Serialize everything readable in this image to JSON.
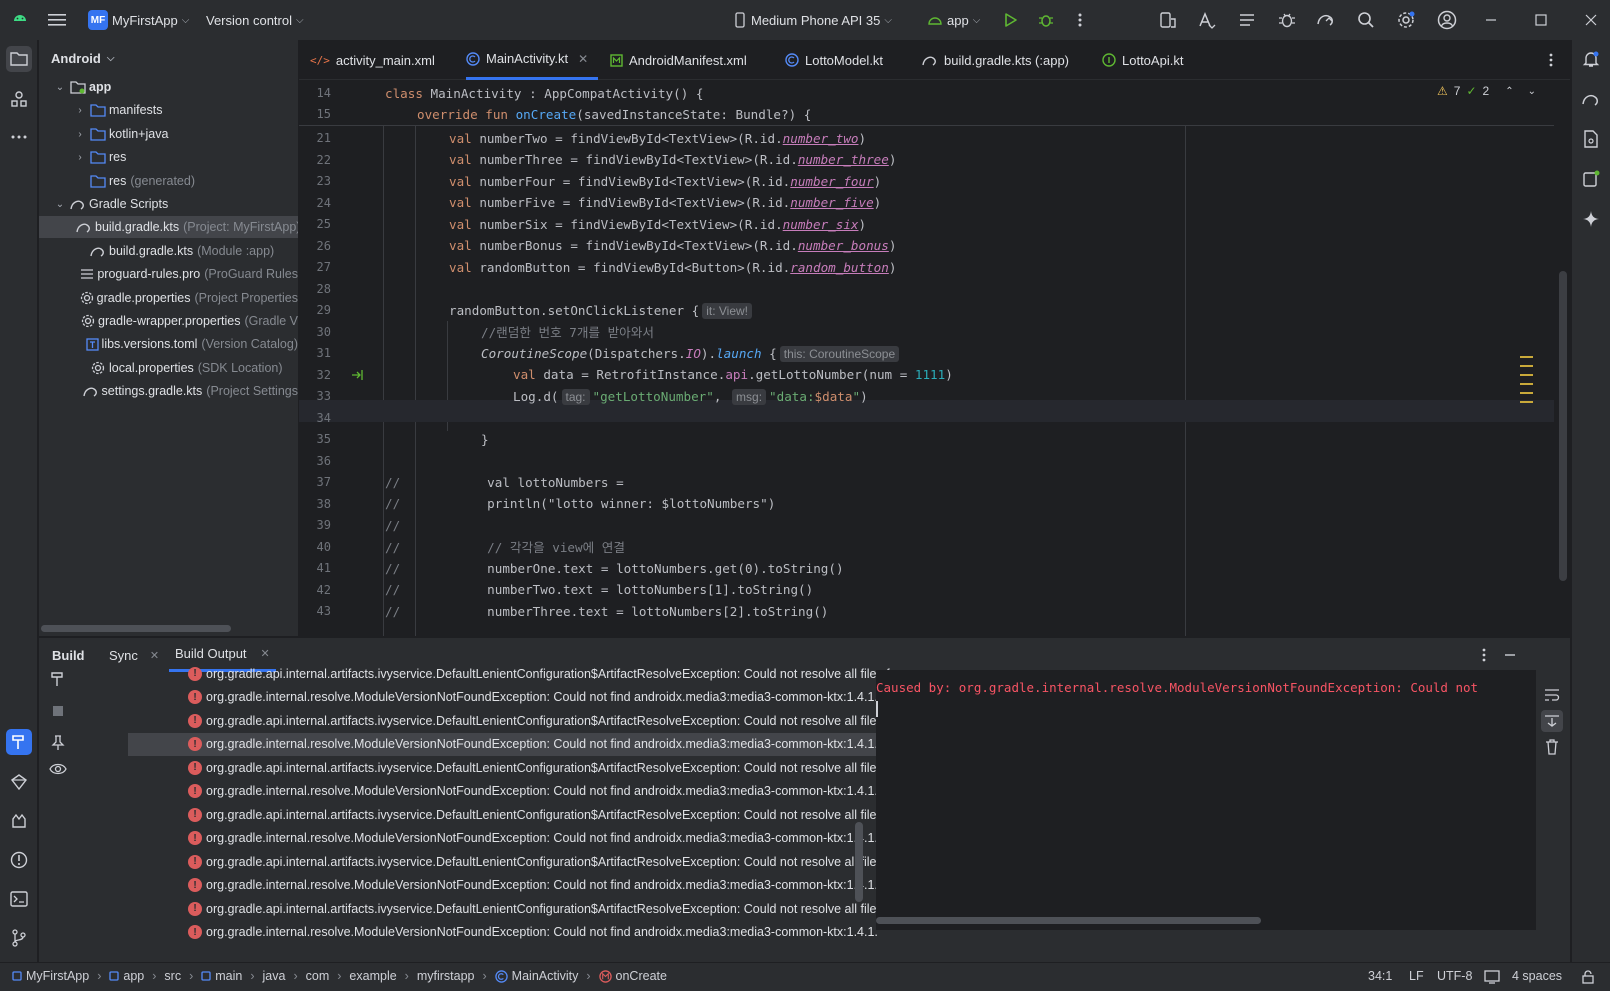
{
  "titlebar": {
    "project_badge": "MF",
    "project_name": "MyFirstApp",
    "version_control": "Version control",
    "device": "Medium Phone API 35",
    "run_config": "app"
  },
  "project_panel": {
    "view_name": "Android",
    "items": [
      {
        "label": "app",
        "hint": ""
      },
      {
        "label": "manifests",
        "hint": ""
      },
      {
        "label": "kotlin+java",
        "hint": ""
      },
      {
        "label": "res",
        "hint": ""
      },
      {
        "label": "res",
        "hint": "(generated)"
      },
      {
        "label": "Gradle Scripts",
        "hint": ""
      },
      {
        "label": "build.gradle.kts",
        "hint": "(Project: MyFirstApp)"
      },
      {
        "label": "build.gradle.kts",
        "hint": "(Module :app)"
      },
      {
        "label": "proguard-rules.pro",
        "hint": "(ProGuard Rules"
      },
      {
        "label": "gradle.properties",
        "hint": "(Project Properties"
      },
      {
        "label": "gradle-wrapper.properties",
        "hint": "(Gradle V"
      },
      {
        "label": "libs.versions.toml",
        "hint": "(Version Catalog)"
      },
      {
        "label": "local.properties",
        "hint": "(SDK Location)"
      },
      {
        "label": "settings.gradle.kts",
        "hint": "(Project Settings"
      }
    ]
  },
  "tabs": [
    {
      "label": "activity_main.xml"
    },
    {
      "label": "MainActivity.kt"
    },
    {
      "label": "AndroidManifest.xml"
    },
    {
      "label": "LottoModel.kt"
    },
    {
      "label": "build.gradle.kts (:app)"
    },
    {
      "label": "LottoApi.kt"
    }
  ],
  "editor": {
    "warnings": "7",
    "weak_warnings": "2",
    "line_numbers": [
      "14",
      "15",
      "21",
      "22",
      "23",
      "24",
      "25",
      "26",
      "27",
      "28",
      "29",
      "30",
      "31",
      "32",
      "33",
      "34",
      "35",
      "36",
      "37",
      "38",
      "39",
      "40",
      "41",
      "42",
      "43"
    ],
    "line_14": {
      "kw": "class",
      "name": " MainActivity : AppCompatActivity() {"
    },
    "line_15": {
      "kw": "override fun",
      "fn": "onCreate",
      "rest": "(savedInstanceState: Bundle?) {"
    },
    "vals": [
      {
        "name": "numberTwo",
        "type": "TextView",
        "id": "number_two"
      },
      {
        "name": "numberThree",
        "type": "TextView",
        "id": "number_three"
      },
      {
        "name": "numberFour",
        "type": "TextView",
        "id": "number_four"
      },
      {
        "name": "numberFive",
        "type": "TextView",
        "id": "number_five"
      },
      {
        "name": "numberSix",
        "type": "TextView",
        "id": "number_six"
      },
      {
        "name": "numberBonus",
        "type": "TextView",
        "id": "number_bonus"
      },
      {
        "name": "randomButton",
        "type": "Button",
        "id": "random_button"
      }
    ],
    "line_29": {
      "code": "randomButton.setOnClickListener {",
      "hint": "it: View!"
    },
    "line_30": "//랜덤한 번호 7개를 받아와서",
    "line_31": {
      "a": "CoroutineScope",
      "b": "(Dispatchers.",
      "c": "IO",
      "d": ").",
      "e": "launch",
      "f": " {",
      "hint": "this: CoroutineScope"
    },
    "line_32": {
      "a": "val",
      "b": " data = RetrofitInstance.",
      "c": "api",
      "d": ".getLottoNumber(",
      "e": "num = ",
      "f": "1111",
      "g": ")"
    },
    "line_33": {
      "a": "Log.d(",
      "tag_hint": "tag:",
      "tag": "\"getLottoNumber\"",
      "comma": ",",
      "msg_hint": "msg:",
      "msg_a": "\"data:",
      "msg_b": "$data",
      "msg_c": "\"",
      "end": ")"
    },
    "line_35": "}",
    "commented": [
      {
        "prefix": "//",
        "code": "val lottoNumbers ="
      },
      {
        "prefix": "//",
        "code": "println(\"lotto winner: $lottoNumbers\")"
      },
      {
        "prefix": "//",
        "code": ""
      },
      {
        "prefix": "//",
        "code": "// 각각을 view에 연결"
      },
      {
        "prefix": "//",
        "code": "numberOne.text = lottoNumbers.get(0).toString()"
      },
      {
        "prefix": "//",
        "code": "numberTwo.text = lottoNumbers[1].toString()"
      },
      {
        "prefix": "//",
        "code": "numberThree.text = lottoNumbers[2].toString()"
      }
    ]
  },
  "build_panel": {
    "tabs": [
      {
        "label": "Build"
      },
      {
        "label": "Sync"
      },
      {
        "label": "Build Output"
      }
    ],
    "errors": [
      "org.gradle.api.internal.artifacts.ivyservice.DefaultLenientConfiguration$ArtifactResolveException: Could not resolve all files for configur",
      "org.gradle.internal.resolve.ModuleVersionNotFoundException: Could not find androidx.media3:media3-common-ktx:1.4.1.",
      "org.gradle.api.internal.artifacts.ivyservice.DefaultLenientConfiguration$ArtifactResolveException: Could not resolve all files for configur",
      "org.gradle.internal.resolve.ModuleVersionNotFoundException: Could not find androidx.media3:media3-common-ktx:1.4.1.",
      "org.gradle.api.internal.artifacts.ivyservice.DefaultLenientConfiguration$ArtifactResolveException: Could not resolve all files for configur",
      "org.gradle.internal.resolve.ModuleVersionNotFoundException: Could not find androidx.media3:media3-common-ktx:1.4.1.",
      "org.gradle.api.internal.artifacts.ivyservice.DefaultLenientConfiguration$ArtifactResolveException: Could not resolve all files for configur",
      "org.gradle.internal.resolve.ModuleVersionNotFoundException: Could not find androidx.media3:media3-common-ktx:1.4.1.",
      "org.gradle.api.internal.artifacts.ivyservice.DefaultLenientConfiguration$ArtifactResolveException: Could not resolve all files for configur",
      "org.gradle.internal.resolve.ModuleVersionNotFoundException: Could not find androidx.media3:media3-common-ktx:1.4.1.",
      "org.gradle.api.internal.artifacts.ivyservice.DefaultLenientConfiguration$ArtifactResolveException: Could not resolve all files for configur",
      "org.gradle.internal.resolve.ModuleVersionNotFoundException: Could not find androidx.media3:media3-common-ktx:1.4.1."
    ],
    "console_text": "Caused by: org.gradle.internal.resolve.ModuleVersionNotFoundException: Could not"
  },
  "statusbar": {
    "crumbs": [
      "MyFirstApp",
      "app",
      "src",
      "main",
      "java",
      "com",
      "example",
      "myfirstapp",
      "MainActivity",
      "onCreate"
    ],
    "position": "34:1",
    "line_sep": "LF",
    "encoding": "UTF-8",
    "indent": "4 spaces"
  },
  "colors": {
    "accent": "#3574f0",
    "error": "#db5c5c",
    "warning": "#f2c55c",
    "console_error": "#f75464"
  }
}
